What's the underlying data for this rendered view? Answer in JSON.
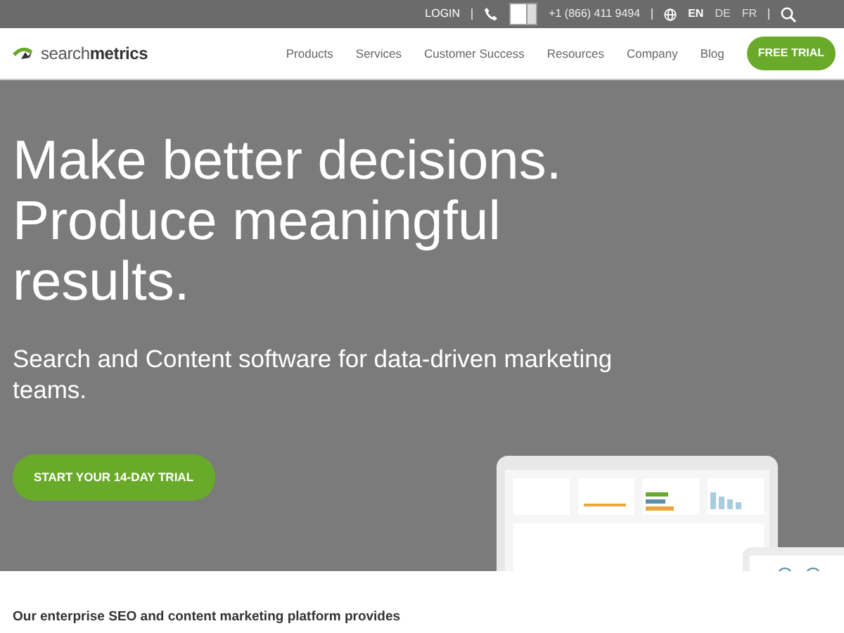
{
  "top_bar": {
    "login": "LOGIN",
    "phone": "+1 (866) 411 9494",
    "languages": [
      {
        "label": "EN",
        "selected": true
      },
      {
        "label": "DE",
        "selected": false
      },
      {
        "label": "FR",
        "selected": false
      }
    ]
  },
  "nav": {
    "logo": "search**metrics**",
    "items": [
      "Products",
      "Services",
      "Customer Success",
      "Resources",
      "Company",
      "Blog"
    ],
    "cta": "FREE TRIAL"
  },
  "hero": {
    "headline": "Make better decisions. Produce meaningful results.",
    "subtitle": "Search and Content software for data-driven marketing teams.",
    "button": "START YOUR 14-DAY TRIAL"
  },
  "intro": {
    "text": "Our enterprise SEO and content marketing platform provides"
  }
}
